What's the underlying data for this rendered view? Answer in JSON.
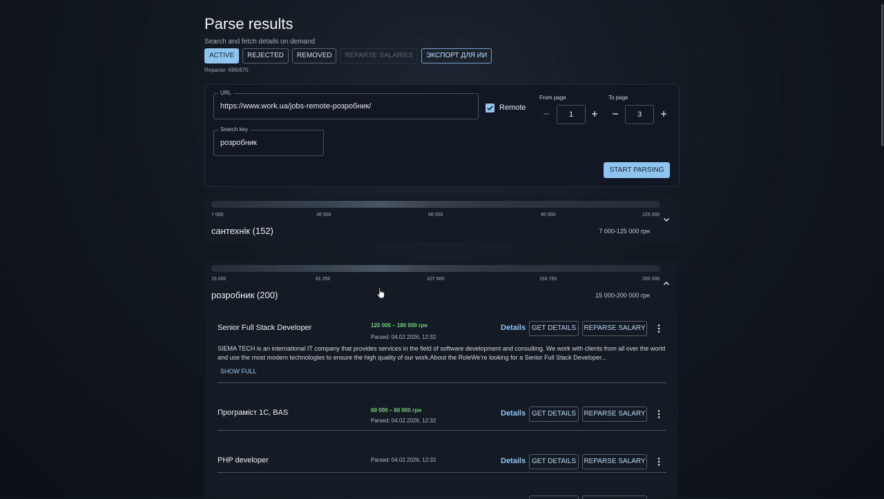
{
  "header": {
    "title": "Parse results",
    "subtitle": "Search and fetch details on demand",
    "tabs": [
      {
        "label": "ACTIVE",
        "state": "active"
      },
      {
        "label": "REJECTED",
        "state": "normal"
      },
      {
        "label": "REMOVED",
        "state": "normal"
      },
      {
        "label": "REPARSE SALARIES",
        "state": "disabled"
      },
      {
        "label": "ЭКСПОРТ ДЛЯ ИИ",
        "state": "normal"
      }
    ],
    "reparse_status": "Reparse: 686/870"
  },
  "form": {
    "url_label": "URL",
    "url_value": "https://www.work.ua/jobs-remote-розробник/",
    "remote_label": "Remote",
    "remote_checked": true,
    "from_page_label": "From page",
    "from_page_value": "1",
    "to_page_label": "To page",
    "to_page_value": "3",
    "search_key_label": "Search key",
    "search_key_value": "розробник",
    "start_button": "START PARSING"
  },
  "groups": [
    {
      "title": "сантехнік (152)",
      "range": "7 000-125 000 грн",
      "ticks": [
        "7 000",
        "36 500",
        "66 000",
        "95 500",
        "125 000"
      ],
      "expanded": false
    },
    {
      "title": "розробник (200)",
      "range": "15 000-200 000 грн",
      "ticks": [
        "15 000",
        "61 250",
        "107 500",
        "153 750",
        "200 000"
      ],
      "expanded": true,
      "jobs": [
        {
          "title": "Senior Full Stack Developer",
          "salary": "120 000 – 180 000 грн",
          "parsed": "Parsed: 04.02.2026, 12:32",
          "details": "Details",
          "get_details": "GET DETAILS",
          "reparse_salary": "REPARSE SALARY",
          "description": "SIEMA TECH is an international IT company that provides services in the field of software development and consulting. We work with clients from all over the world and use the most modern technologies to ensure the high quality of our work.About the RoleWe’re looking for a Senior Full Stack Developer...",
          "show_full": "SHOW FULL"
        },
        {
          "title": "Програміст 1С, BAS",
          "salary": "60 000 – 80 000 грн",
          "parsed": "Parsed: 04.02.2026, 12:32",
          "details": "Details",
          "get_details": "GET DETAILS",
          "reparse_salary": "REPARSE SALARY"
        },
        {
          "title": "PHP developer",
          "parsed": "Parsed: 04.02.2026, 12:32",
          "details": "Details",
          "get_details": "GET DETAILS",
          "reparse_salary": "REPARSE SALARY"
        }
      ]
    }
  ],
  "colors": {
    "accent": "#8fc4ee",
    "salary": "#6fd07a",
    "link": "#8cc4f2",
    "card": "#111823"
  },
  "icons": [
    "check-icon",
    "minus-icon",
    "plus-icon",
    "chevron-down-icon",
    "chevron-up-icon",
    "more-vert-icon",
    "cursor-icon"
  ]
}
